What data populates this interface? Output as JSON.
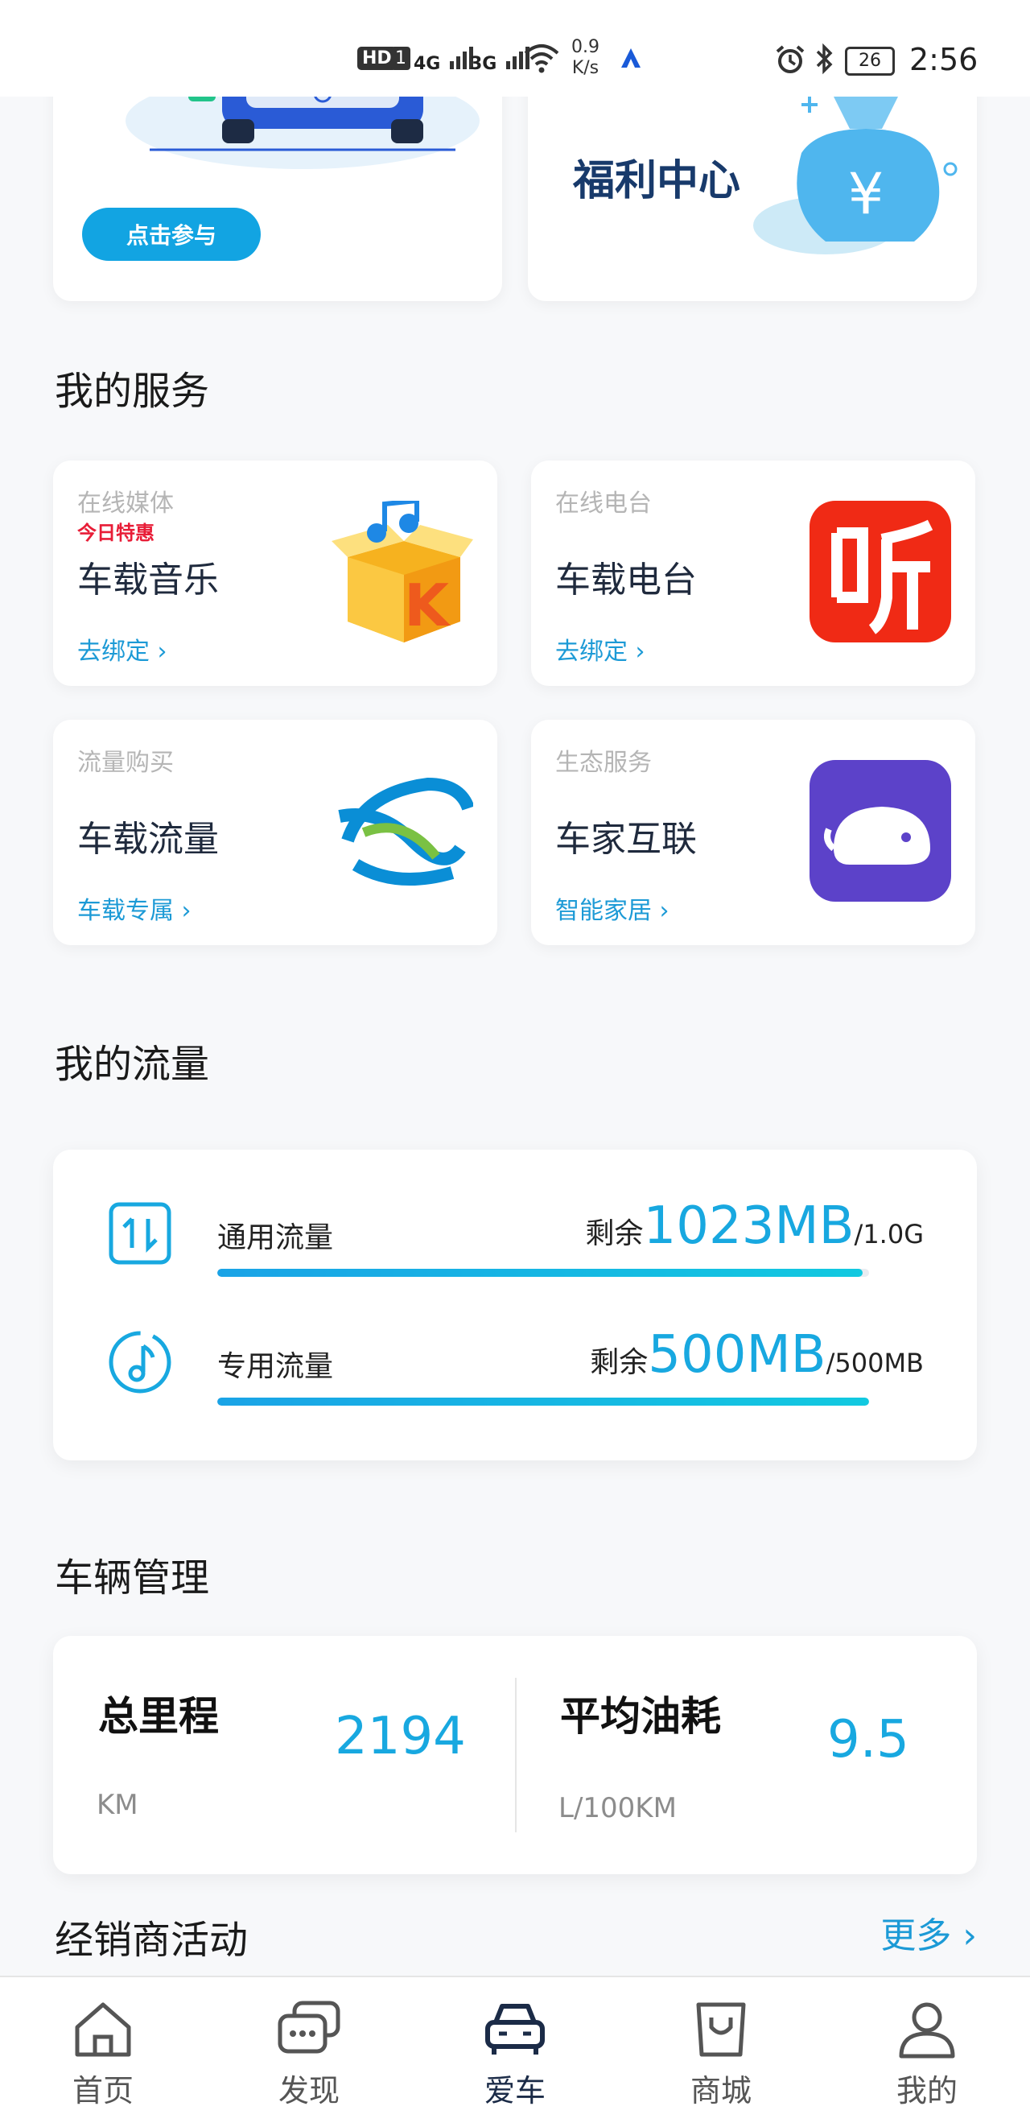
{
  "status_bar": {
    "hd": "HD",
    "sim": "1",
    "net1": "4G",
    "net2": "3G",
    "speed_value": "0.9",
    "speed_unit": "K/s",
    "battery": "26",
    "time": "2:56"
  },
  "top_cards": {
    "join_label": "点击参与",
    "welfare_title": "福利中心",
    "welfare_symbol": "¥"
  },
  "services": {
    "title": "我的服务",
    "items": [
      {
        "category": "在线媒体",
        "badge": "今日特惠",
        "name": "车载音乐",
        "link": "去绑定",
        "icon": "kuwo-music-box-icon"
      },
      {
        "category": "在线电台",
        "badge": "",
        "name": "车载电台",
        "link": "去绑定",
        "icon": "ting-radio-icon"
      },
      {
        "category": "流量购买",
        "badge": "",
        "name": "车载流量",
        "link": "车载专属",
        "icon": "china-mobile-logo-icon"
      },
      {
        "category": "生态服务",
        "badge": "",
        "name": "车家互联",
        "link": "智能家居",
        "icon": "whale-app-icon"
      }
    ]
  },
  "traffic": {
    "title": "我的流量",
    "rows": [
      {
        "label": "通用流量",
        "remain_prefix": "剩余",
        "remain": "1023MB",
        "total": "/1.0G",
        "fill_fraction": 0.99,
        "icon": "data-transfer-icon"
      },
      {
        "label": "专用流量",
        "remain_prefix": "剩余",
        "remain": "500MB",
        "total": "/500MB",
        "fill_fraction": 1.0,
        "icon": "music-note-icon"
      }
    ]
  },
  "vehicle": {
    "title": "车辆管理",
    "mileage_title": "总里程",
    "mileage_value": "2194",
    "mileage_unit": "KM",
    "fuel_title": "平均油耗",
    "fuel_value": "9.5",
    "fuel_unit": "L/100KM"
  },
  "dealer": {
    "title": "经销商活动",
    "more": "更多"
  },
  "tabbar": {
    "tabs": [
      {
        "label": "首页",
        "icon": "home-icon"
      },
      {
        "label": "发现",
        "icon": "discover-chat-icon"
      },
      {
        "label": "爱车",
        "icon": "car-icon"
      },
      {
        "label": "商城",
        "icon": "shopping-bag-icon"
      },
      {
        "label": "我的",
        "icon": "profile-icon"
      }
    ],
    "active_index": 2
  },
  "colors": {
    "accent": "#18a8e0",
    "link": "#1c9ad6",
    "badge_red": "#e81d37",
    "background": "#f7f8fa"
  }
}
